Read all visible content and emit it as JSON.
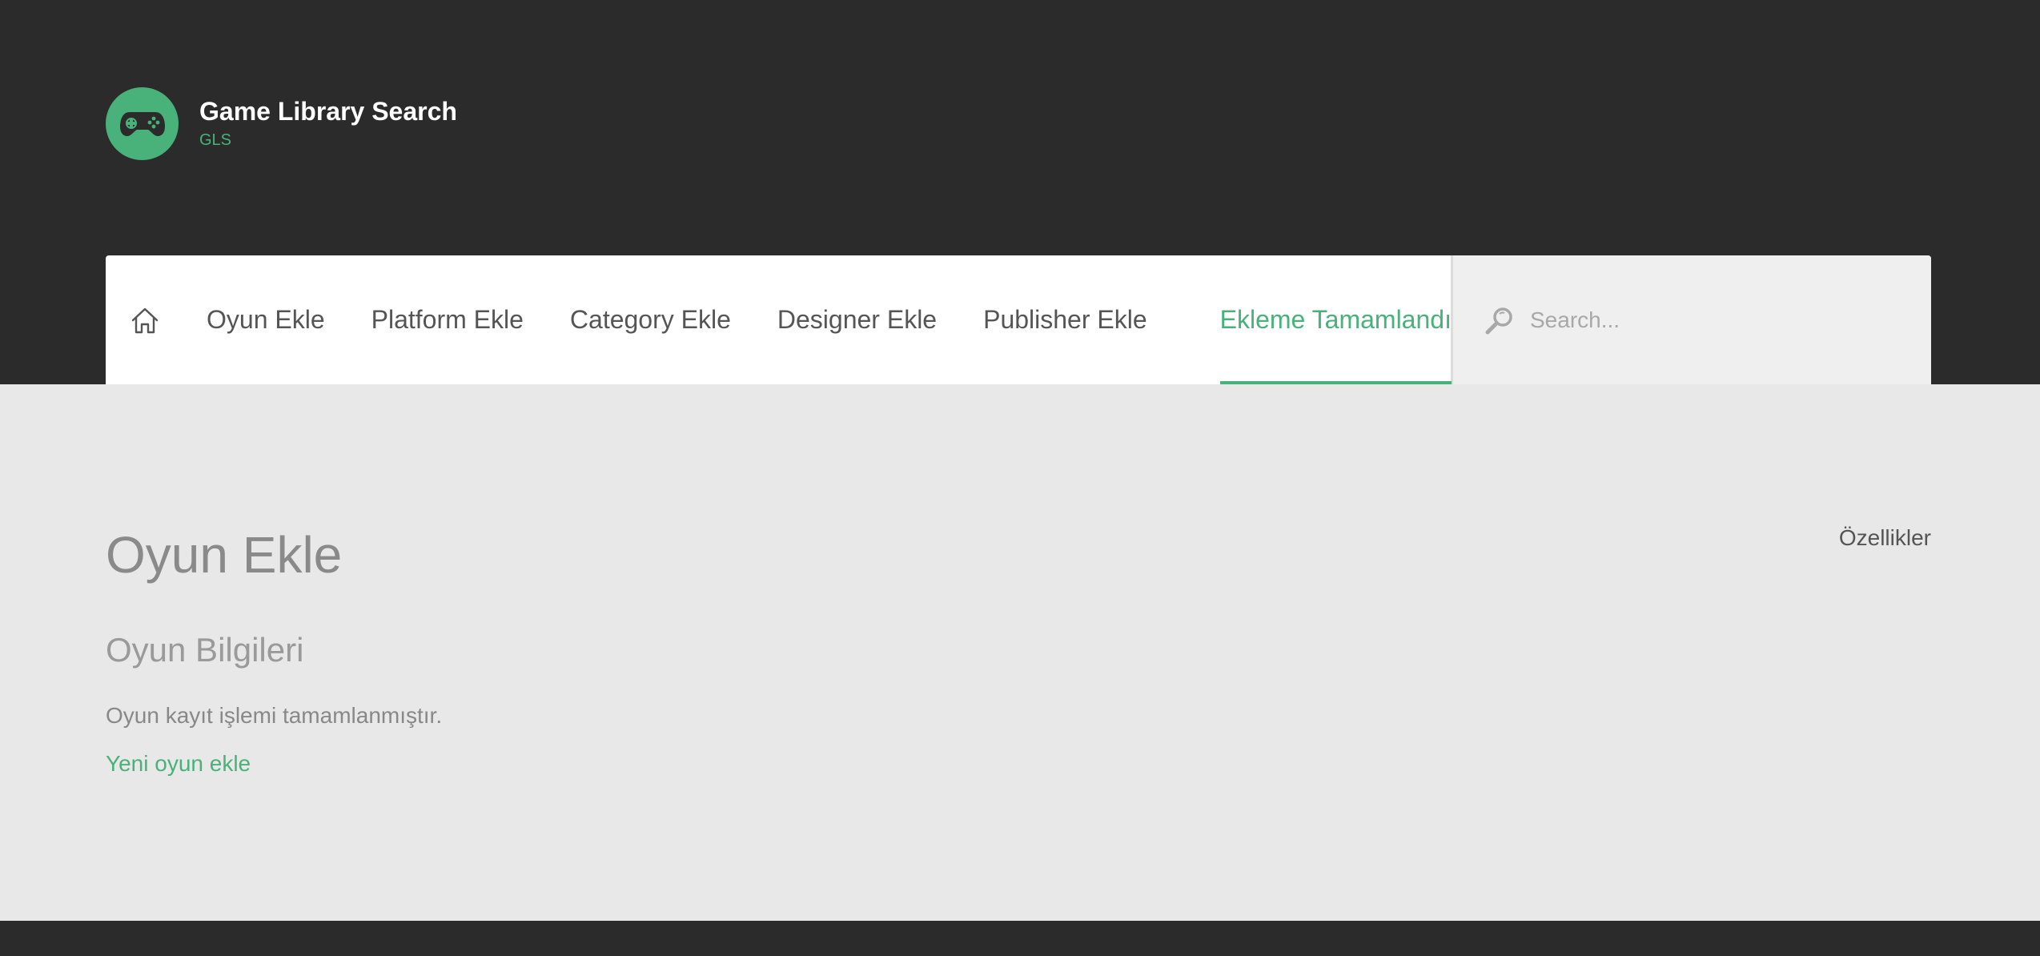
{
  "brand": {
    "title": "Game Library Search",
    "subtitle": "GLS",
    "logo_icon": "gamepad-icon"
  },
  "nav": {
    "home_icon": "home-icon",
    "items": [
      {
        "label": "Oyun Ekle"
      },
      {
        "label": "Platform Ekle"
      },
      {
        "label": "Category Ekle"
      },
      {
        "label": "Designer Ekle"
      },
      {
        "label": "Publisher Ekle"
      }
    ],
    "active_label": "Ekleme Tamamlandı"
  },
  "search": {
    "placeholder": "Search...",
    "icon": "search-icon"
  },
  "main": {
    "page_title": "Oyun Ekle",
    "features_link": "Özellikler",
    "section_title": "Oyun Bilgileri",
    "message": "Oyun kayıt işlemi tamamlanmıştır.",
    "new_link": "Yeni oyun ekle"
  },
  "colors": {
    "accent": "#48b27a",
    "header_bg": "#2b2b2b",
    "body_bg": "#e8e8e8"
  }
}
